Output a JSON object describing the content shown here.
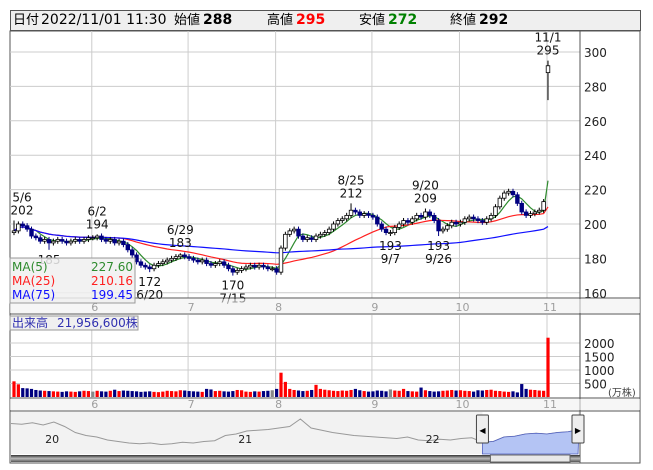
{
  "header": {
    "date_label": "日付",
    "datetime": "2022/11/01 11:30",
    "open_label": "始値",
    "open": "288",
    "high_label": "高値",
    "high": "295",
    "low_label": "安値",
    "low": "272",
    "close_label": "終値",
    "close": "292"
  },
  "colors": {
    "up_body": "#ffffff",
    "down_body": "#000080",
    "ma5": "#2e8b2e",
    "ma25": "#ff2020",
    "ma75": "#1010ff",
    "vol_up": "#ff0000",
    "vol_down": "#000080",
    "vol_flat": "#888888",
    "high_text": "#ff0000",
    "low_text": "#008000",
    "nav_sel": "#b4c4f4"
  },
  "legend": {
    "ma5_label": "MA(5)",
    "ma5": "227.60",
    "ma25_label": "MA(25)",
    "ma25": "210.16",
    "ma75_label": "MA(75)",
    "ma75": "199.45"
  },
  "volume_legend": {
    "label": "出来高",
    "value": "21,956,600株"
  },
  "chart_data": {
    "type": "candlestick",
    "price_axis": {
      "ticks": [
        160,
        180,
        200,
        220,
        240,
        260,
        280,
        300
      ],
      "range": [
        156,
        314
      ]
    },
    "volume_axis": {
      "ticks": [
        500,
        1000,
        1500,
        2000
      ],
      "unit": "(万株)"
    },
    "months": [
      {
        "label": "6",
        "index": 18
      },
      {
        "label": "7",
        "index": 40
      },
      {
        "label": "8",
        "index": 60
      },
      {
        "label": "9",
        "index": 82
      },
      {
        "label": "10",
        "index": 102
      },
      {
        "label": "11",
        "index": 122
      }
    ],
    "closes": [
      196,
      200,
      199,
      197,
      193,
      192,
      190,
      191,
      189,
      190,
      191,
      190,
      189,
      190,
      191,
      190,
      191,
      192,
      192,
      193,
      191,
      190,
      191,
      189,
      190,
      188,
      185,
      182,
      178,
      176,
      175,
      174,
      176,
      177,
      178,
      179,
      180,
      181,
      182,
      181,
      180,
      179,
      178,
      179,
      177,
      176,
      177,
      178,
      176,
      174,
      172,
      173,
      174,
      175,
      176,
      175,
      176,
      175,
      174,
      174,
      172,
      186,
      194,
      196,
      197,
      193,
      191,
      192,
      191,
      193,
      194,
      195,
      197,
      200,
      202,
      203,
      205,
      208,
      207,
      205,
      206,
      205,
      204,
      200,
      197,
      195,
      195,
      198,
      200,
      202,
      201,
      203,
      205,
      204,
      207,
      205,
      202,
      196,
      197,
      199,
      201,
      200,
      201,
      203,
      204,
      203,
      202,
      201,
      203,
      205,
      210,
      215,
      218,
      219,
      217,
      212,
      207,
      205,
      206,
      207,
      208,
      213,
      292
    ],
    "first_open": 195,
    "last_candle": {
      "open": 288,
      "high": 295,
      "low": 272,
      "close": 292
    },
    "volumes": [
      580,
      470,
      330,
      320,
      300,
      260,
      240,
      230,
      220,
      210,
      200,
      190,
      210,
      200,
      190,
      210,
      230,
      220,
      200,
      230,
      210,
      200,
      230,
      270,
      220,
      240,
      230,
      220,
      210,
      190,
      200,
      210,
      190,
      180,
      200,
      230,
      220,
      210,
      250,
      240,
      220,
      210,
      200,
      190,
      300,
      280,
      220,
      230,
      210,
      200,
      220,
      260,
      250,
      200,
      190,
      210,
      200,
      220,
      230,
      250,
      300,
      900,
      560,
      300,
      260,
      240,
      220,
      230,
      260,
      450,
      300,
      270,
      250,
      230,
      220,
      240,
      230,
      260,
      300,
      250,
      220,
      200,
      210,
      240,
      230,
      210,
      280,
      240,
      230,
      300,
      220,
      210,
      200,
      350,
      250,
      220,
      200,
      210,
      230,
      240,
      260,
      240,
      250,
      230,
      220,
      200,
      250,
      240,
      260,
      270,
      230,
      220,
      200,
      190,
      210,
      170,
      480,
      300,
      270,
      260,
      240,
      230,
      2196
    ],
    "annotations": [
      {
        "index": 0,
        "date": "5/6",
        "value": 202,
        "kind": "high"
      },
      {
        "index": 19,
        "date": "6/2",
        "value": 194,
        "kind": "high"
      },
      {
        "index": 8,
        "date": "",
        "value": 185,
        "kind": "low"
      },
      {
        "index": 31,
        "date": "6/20",
        "value": 172,
        "kind": "low"
      },
      {
        "index": 38,
        "date": "6/29",
        "value": 183,
        "kind": "high"
      },
      {
        "index": 50,
        "date": "7/15",
        "value": 170,
        "kind": "low"
      },
      {
        "index": 77,
        "date": "8/25",
        "value": 212,
        "kind": "high"
      },
      {
        "index": 86,
        "date": "9/7",
        "value": 193,
        "kind": "low"
      },
      {
        "index": 94,
        "date": "9/20",
        "value": 209,
        "kind": "high"
      },
      {
        "index": 97,
        "date": "9/26",
        "value": 193,
        "kind": "low"
      },
      {
        "index": 122,
        "date": "11/1",
        "value": 295,
        "kind": "high"
      }
    ],
    "navigator": {
      "years": [
        {
          "label": "20",
          "pos": 0.06
        },
        {
          "label": "21",
          "pos": 0.4
        },
        {
          "label": "22",
          "pos": 0.73
        }
      ],
      "series": [
        230,
        229,
        231,
        228,
        232,
        226,
        218,
        214,
        212,
        208,
        206,
        204,
        203,
        204,
        202,
        203,
        205,
        204,
        206,
        207,
        214,
        216,
        220,
        221,
        222,
        224,
        226,
        236,
        224,
        221,
        218,
        216,
        214,
        213,
        212,
        211,
        210,
        212,
        208,
        207,
        209,
        208,
        210,
        211,
        205,
        206,
        212,
        213,
        216,
        217,
        216,
        218,
        219,
        222
      ],
      "selection_start": 0.83
    }
  }
}
